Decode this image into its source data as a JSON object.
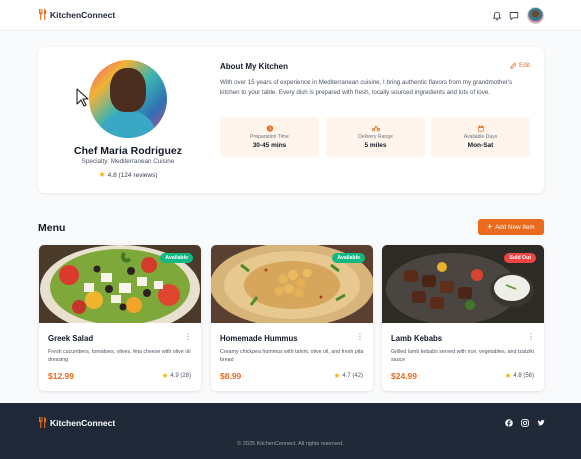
{
  "header": {
    "brand": "KitchenConnect",
    "icons": [
      "bell-icon",
      "chat-icon",
      "user-avatar"
    ]
  },
  "profile": {
    "name": "Chef Maria Rodriguez",
    "specialty": "Specialty: Mediterranean Cuisine",
    "rating": "4.8 (124 reviews)",
    "about_title": "About My Kitchen",
    "edit_label": "Edit",
    "about_text": "With over 15 years of experience in Mediterranean cuisine, I bring authentic flavors from my grandmother's kitchen to your table. Every dish is prepared with fresh, locally sourced ingredients and lots of love.",
    "stats": [
      {
        "label": "Preparation Time",
        "value": "30-45 mins",
        "icon": "clock-icon"
      },
      {
        "label": "Delivery Range",
        "value": "5 miles",
        "icon": "motorcycle-icon"
      },
      {
        "label": "Available Days",
        "value": "Mon-Sat",
        "icon": "calendar-icon"
      }
    ]
  },
  "menu": {
    "title": "Menu",
    "add_label": "Add New Item",
    "items": [
      {
        "name": "Greek Salad",
        "desc": "Fresh cucumbers, tomatoes, olives, feta cheese with olive oil dressing",
        "price": "$12.99",
        "rating": "4.9 (28)",
        "badge": "Available"
      },
      {
        "name": "Homemade Hummus",
        "desc": "Creamy chickpea hummus with tahini, olive oil, and fresh pita bread",
        "price": "$8.99",
        "rating": "4.7 (42)",
        "badge": "Available"
      },
      {
        "name": "Lamb Kebabs",
        "desc": "Grilled lamb kebabs served with rice, vegetables, and tzatziki sauce",
        "price": "$24.99",
        "rating": "4.8 (56)",
        "badge": "Sold Out"
      }
    ]
  },
  "footer": {
    "brand": "KitchenConnect",
    "copyright": "© 2025 KitchenConnect. All rights reserved.",
    "social": [
      "facebook-icon",
      "instagram-icon",
      "twitter-icon"
    ]
  },
  "colors": {
    "accent": "#ea6a1e",
    "available": "#10b981",
    "sold_out": "#ef4444",
    "footer_bg": "#1f2937"
  }
}
